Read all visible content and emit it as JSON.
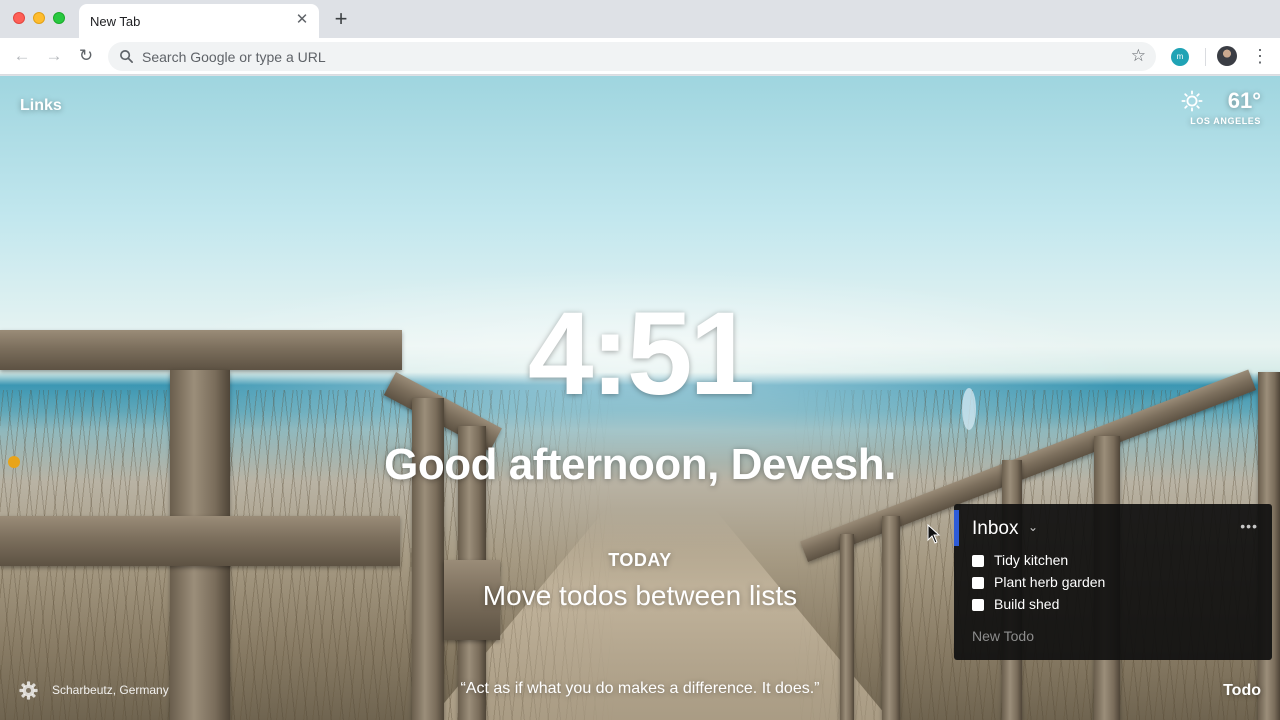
{
  "browser": {
    "tab": {
      "title": "New Tab",
      "close": "✕"
    },
    "new_tab": "+",
    "nav": {
      "back": "←",
      "forward": "→",
      "reload": "↻"
    },
    "omnibox": {
      "placeholder": "Search Google or type a URL"
    },
    "bookmark_star": "☆",
    "extension_label": "m",
    "menu": "⋮"
  },
  "dashboard": {
    "links": "Links",
    "weather": {
      "temperature": "61°",
      "location": "LOS ANGELES"
    },
    "clock": "4:51",
    "greeting": "Good afternoon, Devesh.",
    "focus": {
      "label": "TODAY",
      "text": "Move todos between lists"
    },
    "photo_location": "Scharbeutz, Germany",
    "quote": "“Act as if what you do makes a difference. It does.”",
    "todo_link": "Todo"
  },
  "todo_panel": {
    "list_name": "Inbox",
    "chevron": "⌄",
    "more": "•••",
    "items": [
      {
        "label": "Tidy kitchen",
        "checked": false
      },
      {
        "label": "Plant herb garden",
        "checked": false
      },
      {
        "label": "Build shed",
        "checked": false
      }
    ],
    "new_placeholder": "New Todo"
  },
  "colors": {
    "todo_accent": "#2d5bd8",
    "extension": "#20a3b5"
  }
}
